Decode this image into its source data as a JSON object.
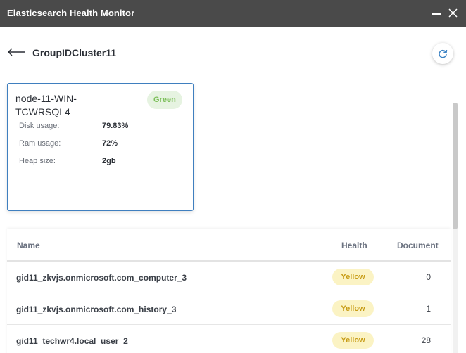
{
  "window": {
    "title": "Elasticsearch Health Monitor"
  },
  "header": {
    "title": "GroupIDCluster11"
  },
  "node": {
    "name": "node-11-WIN-TCWRSQL4",
    "status": "Green",
    "metrics": [
      {
        "label": "Disk usage:",
        "value": "79.83%"
      },
      {
        "label": "Ram usage:",
        "value": "72%"
      },
      {
        "label": "Heap size:",
        "value": "2gb"
      }
    ]
  },
  "table": {
    "columns": {
      "name": "Name",
      "health": "Health",
      "document": "Document"
    },
    "rows": [
      {
        "name": "gid11_zkvjs.onmicrosoft.com_computer_3",
        "health": "Yellow",
        "document": "0"
      },
      {
        "name": "gid11_zkvjs.onmicrosoft.com_history_3",
        "health": "Yellow",
        "document": "1"
      },
      {
        "name": "gid11_techwr4.local_user_2",
        "health": "Yellow",
        "document": "28"
      }
    ]
  },
  "colors": {
    "titlebar": "#4a4a4a",
    "status_green": "#7cbf5a",
    "status_yellow": "#c69a12",
    "card_border": "#3f7fbf"
  },
  "icons": [
    "minimize-icon",
    "close-icon",
    "back-arrow-icon",
    "refresh-icon"
  ]
}
